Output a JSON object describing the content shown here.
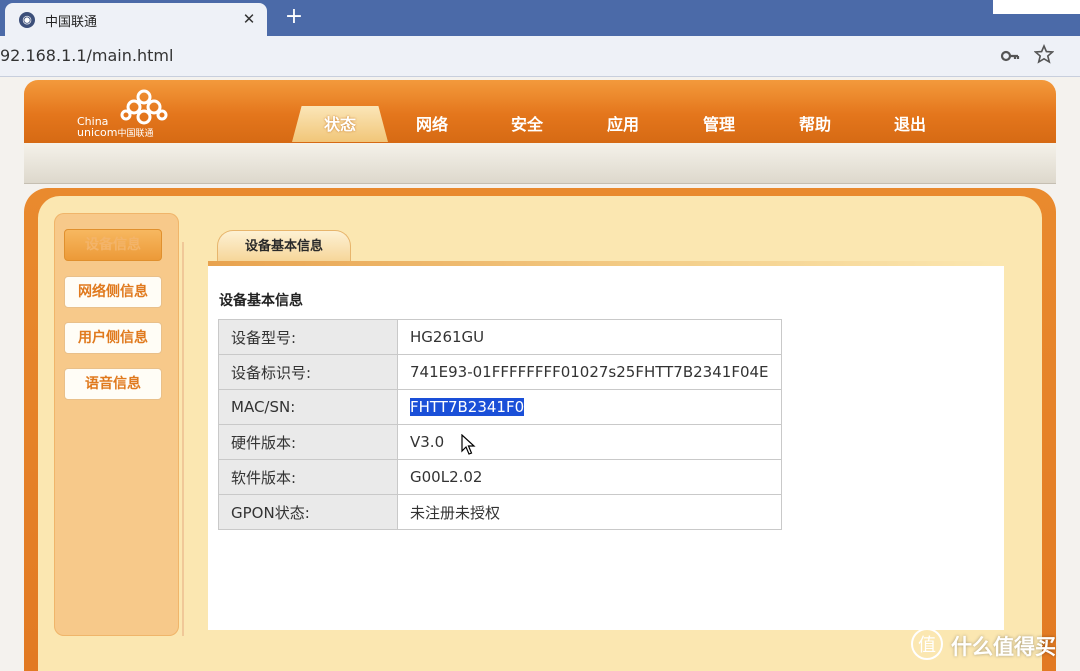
{
  "browser": {
    "tab_title": "中国联通",
    "tab_close": "✕",
    "new_tab": "+",
    "url": "92.168.1.1/main.html"
  },
  "header": {
    "logo_en_1": "China",
    "logo_en_2": "unicom",
    "logo_cn": "中国联通",
    "nav": [
      "状态",
      "网络",
      "安全",
      "应用",
      "管理",
      "帮助",
      "退出"
    ],
    "active_nav": "状态"
  },
  "sidebar": {
    "items": [
      "设备信息",
      "网络侧信息",
      "用户侧信息",
      "语音信息"
    ],
    "active_item": "设备信息"
  },
  "content": {
    "subtab": "设备基本信息",
    "section_title": "设备基本信息",
    "rows": [
      {
        "label": "设备型号:",
        "value": "HG261GU"
      },
      {
        "label": "设备标识号:",
        "value": "741E93-01FFFFFFFF01027s25FHTT7B2341F04E"
      },
      {
        "label": "MAC/SN:",
        "value": "FHTT7B2341F0"
      },
      {
        "label": "硬件版本:",
        "value": "V3.0"
      },
      {
        "label": "软件版本:",
        "value": "G00L2.02"
      },
      {
        "label": "GPON状态:",
        "value": "未注册未授权"
      }
    ]
  },
  "watermark": {
    "icon": "值",
    "text": "什么值得买"
  },
  "colors": {
    "header_orange": "#e4761c",
    "sidebar_bg": "#f7c98a",
    "frame_cream": "#fbe7b1",
    "selection_blue": "#1a4fd8"
  },
  "icons": {
    "favicon": "globe-icon",
    "key": "key-icon",
    "bookmark": "star-icon",
    "cursor": "mouse-pointer-icon"
  }
}
